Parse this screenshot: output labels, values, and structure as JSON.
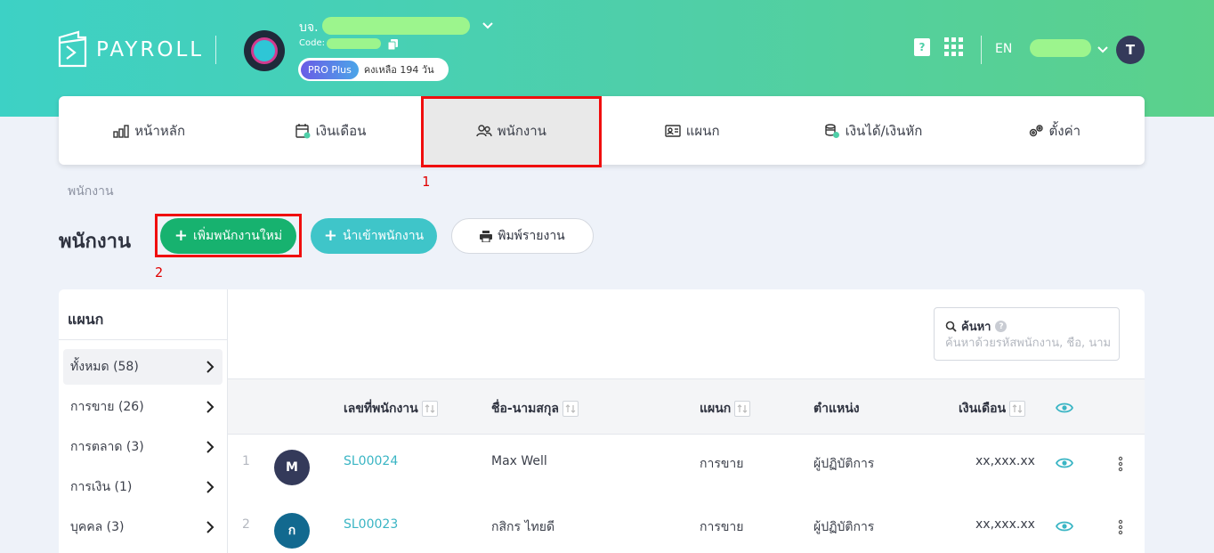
{
  "app": {
    "name": "PAYROLL"
  },
  "company": {
    "prefix": "บจ.",
    "code_label": "Code:",
    "plan": "PRO Plus",
    "days_left": "คงเหลือ 194 วัน"
  },
  "header": {
    "lang": "EN",
    "user_initial": "T"
  },
  "nav": [
    {
      "label": "หน้าหลัก",
      "icon": "chart-bar-icon"
    },
    {
      "label": "เงินเดือน",
      "icon": "calendar-icon"
    },
    {
      "label": "พนักงาน",
      "icon": "users-icon"
    },
    {
      "label": "แผนก",
      "icon": "id-card-icon"
    },
    {
      "label": "เงินได้/เงินหัก",
      "icon": "coins-icon"
    },
    {
      "label": "ตั้งค่า",
      "icon": "gears-icon"
    }
  ],
  "annotations": {
    "one": "1",
    "two": "2"
  },
  "breadcrumb": "พนักงาน",
  "page_title": "พนักงาน",
  "buttons": {
    "add": "เพิ่มพนักงานใหม่",
    "import": "นำเข้าพนักงาน",
    "print": "พิมพ์รายงาน"
  },
  "departments": {
    "title": "แผนก",
    "items": [
      {
        "label": "ทั้งหมด (58)"
      },
      {
        "label": "การขาย (26)"
      },
      {
        "label": "การตลาด (3)"
      },
      {
        "label": "การเงิน (1)"
      },
      {
        "label": "บุคคล (3)"
      }
    ]
  },
  "search": {
    "label": "ค้นหา",
    "placeholder": "ค้นหาด้วยรหัสพนักงาน, ชื่อ, นาม"
  },
  "table": {
    "headers": {
      "emp_id": "เลขที่พนักงาน",
      "name": "ชื่อ-นามสกุล",
      "dept": "แผนก",
      "position": "ตำแหน่ง",
      "salary": "เงินเดือน"
    },
    "rows": [
      {
        "num": "1",
        "initial": "M",
        "emp_id": "SL00024",
        "name": "Max Well",
        "dept": "การขาย",
        "position": "ผู้ปฏิบัติการ",
        "salary": "xx,xxx.xx",
        "avatar_color": "#343a5a"
      },
      {
        "num": "2",
        "initial": "ก",
        "emp_id": "SL00023",
        "name": "กสิกร ไทยดี",
        "dept": "การขาย",
        "position": "ผู้ปฏิบัติการ",
        "salary": "xx,xxx.xx",
        "avatar_color": "#12698f"
      }
    ]
  },
  "colors": {
    "accent": "#17b26f",
    "teal": "#3fc5c9",
    "highlight": "#f00e0e"
  }
}
